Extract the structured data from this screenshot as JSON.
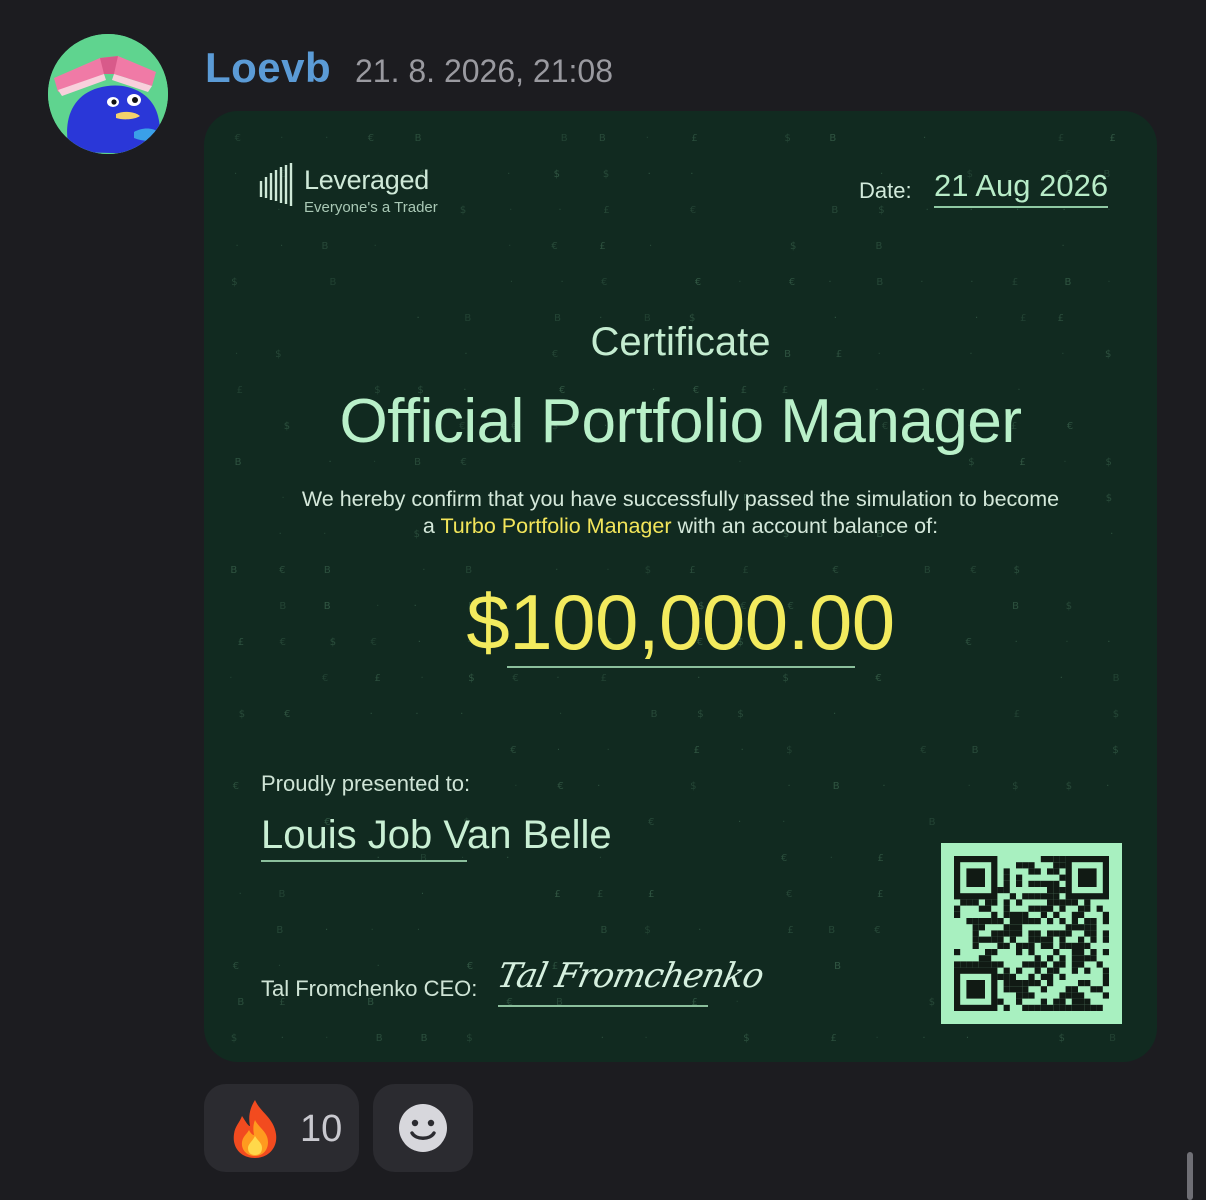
{
  "message": {
    "author": "Loevb",
    "timestamp": "21. 8. 2026, 21:08",
    "avatar_icon": "duck-with-book-avatar"
  },
  "certificate": {
    "brand_name": "Leveraged",
    "brand_tagline": "Everyone's a Trader",
    "date_label": "Date:",
    "date_value": "21 Aug 2026",
    "kicker": "Certificate",
    "title": "Official Portfolio Manager",
    "body_before": "We hereby confirm that you have successfully passed the simulation to become a ",
    "body_highlight": "Turbo Portfolio Manager",
    "body_after": " with an account balance of:",
    "amount": "$100,000.00",
    "presented_label": "Proudly presented to:",
    "recipient": "Louis Job Van Belle",
    "ceo_label": "Tal Fromchenko CEO:",
    "signature": "Tal Fromchenko",
    "qr_icon": "qr-code-icon",
    "colors": {
      "background": "#112a20",
      "accent_green": "#b9f0c9",
      "accent_yellow": "#f3eb5e",
      "qr_background": "#a8f0c0"
    }
  },
  "reactions": [
    {
      "emoji": "fire-icon",
      "count": "10"
    },
    {
      "emoji": "add-reaction-smile-icon"
    }
  ],
  "colors": {
    "app_background": "#1c1c20",
    "author_color": "#5b9bd6",
    "reaction_background": "#2b2b30"
  }
}
